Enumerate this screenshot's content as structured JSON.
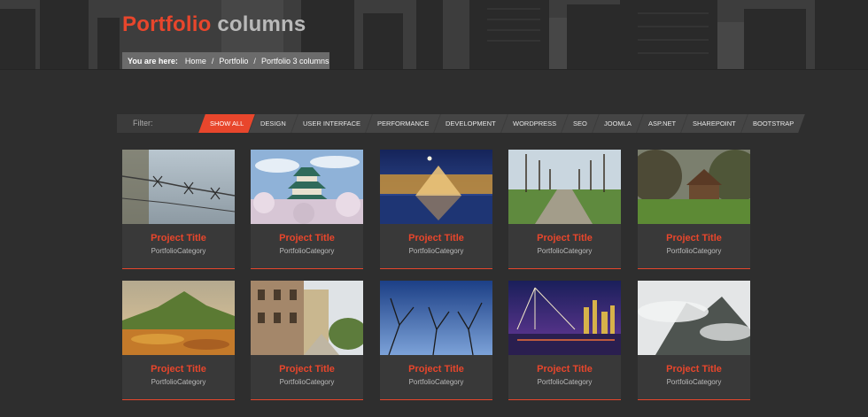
{
  "header": {
    "title_accent": "Portfolio",
    "title_rest": "columns",
    "breadcrumb": {
      "label": "You are here:",
      "items": [
        "Home",
        "Portfolio",
        "Portfolio 3 columns"
      ]
    }
  },
  "filter": {
    "label": "Filter:",
    "items": [
      "SHOW ALL",
      "DESIGN",
      "USER INTERFACE",
      "PERFORMANCE",
      "DEVELOPMENT",
      "WORDPRESS",
      "SEO",
      "JOOMLA",
      "ASP.NET",
      "SHAREPOINT",
      "BOOTSTRAP"
    ],
    "active": "SHOW ALL"
  },
  "portfolio": [
    {
      "title": "Project Title",
      "category": "PortfolioCategory",
      "image": "barbed-wire"
    },
    {
      "title": "Project Title",
      "category": "PortfolioCategory",
      "image": "japanese-castle"
    },
    {
      "title": "Project Title",
      "category": "PortfolioCategory",
      "image": "louvre-pyramid"
    },
    {
      "title": "Project Title",
      "category": "PortfolioCategory",
      "image": "tree-lined-path"
    },
    {
      "title": "Project Title",
      "category": "PortfolioCategory",
      "image": "farmhouse"
    },
    {
      "title": "Project Title",
      "category": "PortfolioCategory",
      "image": "mountain-meadow"
    },
    {
      "title": "Project Title",
      "category": "PortfolioCategory",
      "image": "old-street"
    },
    {
      "title": "Project Title",
      "category": "PortfolioCategory",
      "image": "bare-trees-sky"
    },
    {
      "title": "Project Title",
      "category": "PortfolioCategory",
      "image": "bridge-night"
    },
    {
      "title": "Project Title",
      "category": "PortfolioCategory",
      "image": "misty-mountain"
    }
  ],
  "colors": {
    "accent": "#e8462c",
    "background": "#2e2e2e",
    "card": "#393939"
  }
}
